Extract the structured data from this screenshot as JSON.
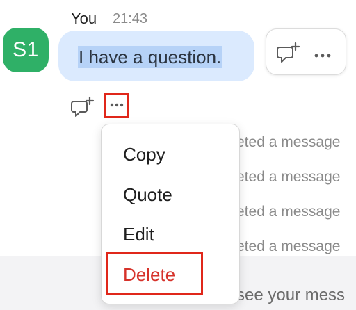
{
  "message": {
    "avatar_initials": "S1",
    "sender": "You",
    "time": "21:43",
    "text": "I have a question."
  },
  "icons": {
    "react": "add-reaction-icon",
    "more": "more-options-icon"
  },
  "system_messages": [
    "eted a message",
    "eted a message",
    "eted a message",
    "eted a message"
  ],
  "bottom_partial_text": "see your mess",
  "context_menu": {
    "items": [
      "Copy",
      "Quote",
      "Edit",
      "Delete"
    ]
  },
  "colors": {
    "avatar_bg": "#2fb067",
    "bubble_bg": "#dbeafe",
    "highlight_box": "#e0271a",
    "delete_text": "#d6322a"
  }
}
